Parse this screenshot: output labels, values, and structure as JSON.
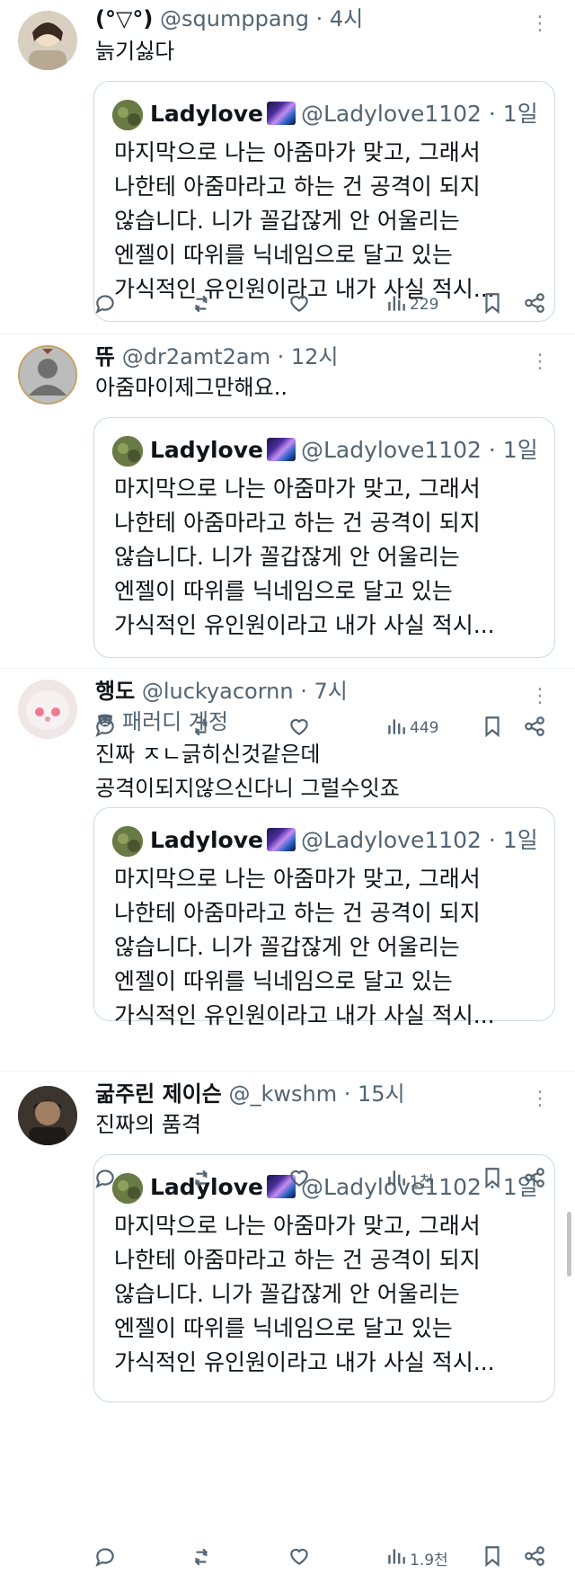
{
  "quoted_tweet": {
    "name": "Ladylove",
    "handle": "@Ladylove1102",
    "time": "· 1일",
    "lines": [
      "마지막으로 나는 아줌마가 맞고, 그래서",
      "나한테 아줌마라고 하는 건 공격이 되지",
      "않습니다. 니가 꼴갑잖게 안 어울리는",
      "엔젤이 따위를 닉네임으로 달고 있는",
      "가식적인 유인원이라고 내가 사실 적시..."
    ]
  },
  "tweets": [
    {
      "name": "(°▽°)",
      "handle": "@squmppang",
      "time": "· 4시",
      "text_lines": [
        "늙기싫다"
      ],
      "views": "229"
    },
    {
      "name": "뜌",
      "handle": "@dr2amt2am",
      "time": "· 12시",
      "text_lines": [
        "아줌마이제그만해요.."
      ],
      "views": "449"
    },
    {
      "name": "행도",
      "handle": "@luckyacornn",
      "time": "· 7시",
      "badge": "패러디 계정",
      "badge_icon": "mask-icon",
      "text_lines": [
        "진짜 ㅈㄴ긁히신것같은데",
        "공격이되지않으신다니 그럴수잇죠"
      ],
      "views": "1천"
    },
    {
      "name": "굶주린 제이슨",
      "handle": "@_kwshm",
      "time": "· 15시",
      "text_lines": [
        "진짜의 품격"
      ],
      "views": "1.9천"
    }
  ],
  "more_glyph": "⋮",
  "colors": {
    "text": "#0f1419",
    "secondary": "#536471",
    "border": "#cfd9de"
  }
}
